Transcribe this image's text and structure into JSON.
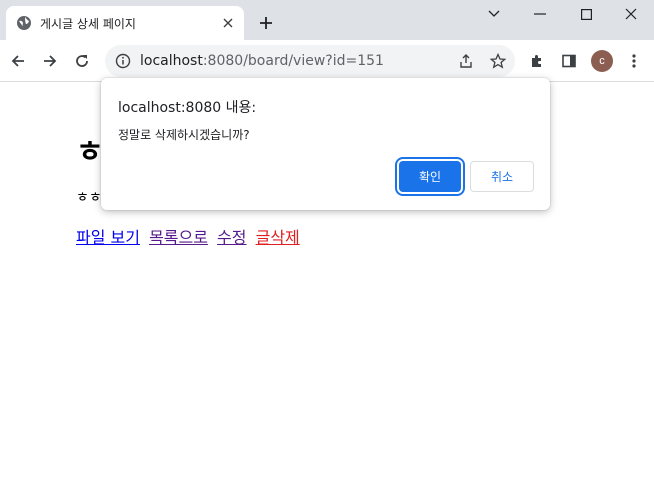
{
  "browser": {
    "tab": {
      "title": "게시글 상세 페이지",
      "favicon": "globe-icon"
    },
    "address_bar": {
      "host": "localhost",
      "rest": ":8080/board/view?id=151"
    },
    "profile_initial": "c"
  },
  "page": {
    "title": "ㅎ",
    "body": "ㅎㅎ",
    "links": {
      "file_view": "파일 보기",
      "to_list": "목록으로",
      "edit": "수정",
      "delete": "글삭제"
    }
  },
  "dialog": {
    "title": "localhost:8080 내용:",
    "message": "정말로 삭제하시겠습니까?",
    "ok_label": "확인",
    "cancel_label": "취소"
  },
  "colors": {
    "accent": "#1a73e8",
    "link_unvisited": "#0000ee",
    "link_visited": "#551a8b",
    "link_delete": "#e02020"
  }
}
